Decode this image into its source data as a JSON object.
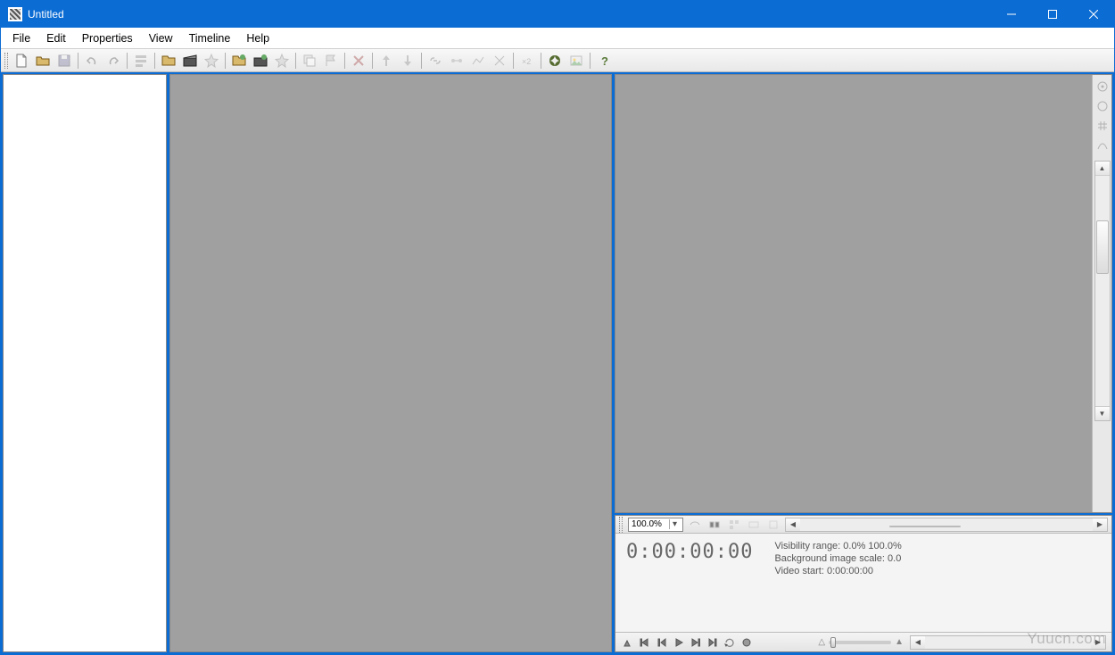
{
  "window": {
    "title": "Untitled"
  },
  "menu": {
    "file": "File",
    "edit": "Edit",
    "properties": "Properties",
    "view": "View",
    "timeline": "Timeline",
    "help": "Help"
  },
  "toolbar": {
    "zoom_value": "100.0%"
  },
  "timeline": {
    "timecode": "0:00:00:00",
    "visibility_range": "Visibility range: 0.0%  100.0%",
    "bg_image_scale": "Background image scale: 0.0",
    "video_start": "Video start: 0:00:00:00"
  },
  "watermark": "Yuucn.com"
}
